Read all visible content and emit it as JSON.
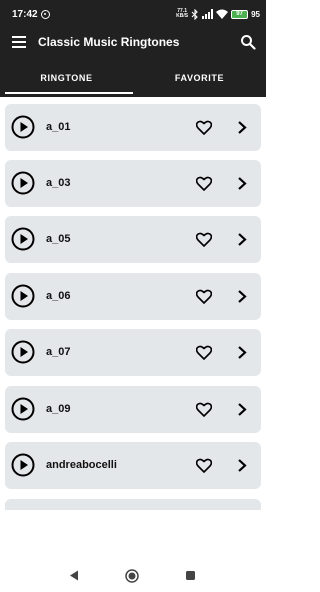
{
  "status_bar": {
    "time": "17:42",
    "speed": "77.1\nKB/S",
    "battery_level": "97",
    "battery_pct_text": "95"
  },
  "app_bar": {
    "title": "Classic Music Ringtones",
    "menu_icon": "menu-icon",
    "search_icon": "search-icon"
  },
  "tabs": [
    {
      "label": "RINGTONE",
      "active": true
    },
    {
      "label": "FAVORITE",
      "active": false
    }
  ],
  "ringtones": [
    {
      "name": "a_01"
    },
    {
      "name": "a_03"
    },
    {
      "name": "a_05"
    },
    {
      "name": "a_06"
    },
    {
      "name": "a_07"
    },
    {
      "name": "a_09"
    },
    {
      "name": "andreabocelli"
    },
    {
      "name": ""
    }
  ],
  "colors": {
    "header_bg": "#212121",
    "card_bg": "#e4e7ea",
    "battery": "#4caf50"
  }
}
